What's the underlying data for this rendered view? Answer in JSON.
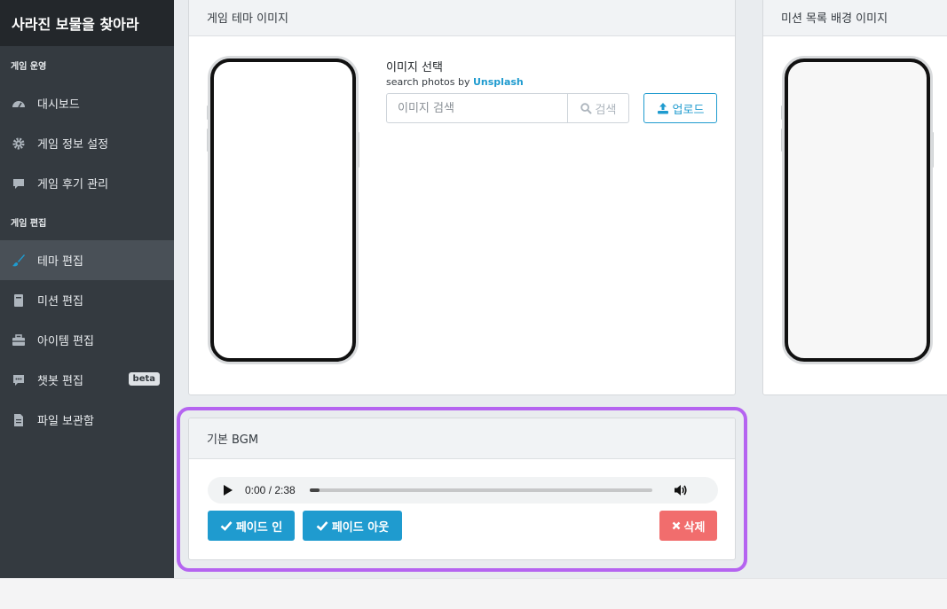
{
  "sidebar": {
    "brand": "사라진 보물을 찾아라",
    "sections": [
      {
        "title": "게임 운영",
        "items": [
          {
            "label": "대시보드",
            "icon": "dashboard-icon"
          },
          {
            "label": "게임 정보 설정",
            "icon": "gear-icon"
          },
          {
            "label": "게임 후기 관리",
            "icon": "comment-icon"
          }
        ]
      },
      {
        "title": "게임 편집",
        "items": [
          {
            "label": "테마 편집",
            "icon": "brush-icon",
            "active": true
          },
          {
            "label": "미션 편집",
            "icon": "book-icon"
          },
          {
            "label": "아이템 편집",
            "icon": "toolbox-icon"
          },
          {
            "label": "챗봇 편집",
            "icon": "chat-icon",
            "badge": "beta"
          },
          {
            "label": "파일 보관함",
            "icon": "file-icon"
          }
        ]
      }
    ]
  },
  "theme_card": {
    "title": "게임 테마 이미지",
    "select_label": "이미지 선택",
    "select_sub_prefix": "search photos by ",
    "select_sub_link": "Unsplash",
    "search_placeholder": "이미지 검색",
    "search_button": "검색",
    "upload_button": "업로드"
  },
  "mission_card": {
    "title": "미션 목록 배경 이미지"
  },
  "bgm_card": {
    "title": "기본 BGM",
    "audio": {
      "current_time": "0:00",
      "duration": "2:38",
      "progress": 0.03
    },
    "fade_in_button": "페이드 인",
    "fade_out_button": "페이드 아웃",
    "delete_button": "삭제"
  },
  "colors": {
    "sidebar_bg": "#343a40",
    "accent": "#1f9bcf",
    "danger": "#f16d6d",
    "highlight": "#b564f0"
  }
}
